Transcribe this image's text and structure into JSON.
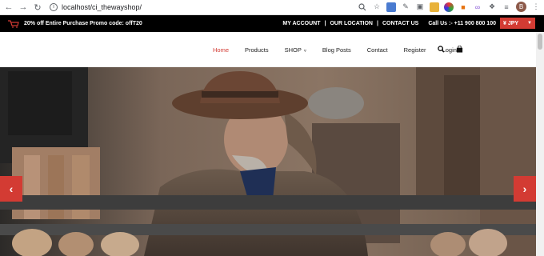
{
  "browser": {
    "url": "localhost/ci_thewayshop/",
    "profile_initial": "B"
  },
  "topbar": {
    "promo": "20% off Entire Purchase Promo code: offT20",
    "links": [
      "MY ACCOUNT",
      "OUR LOCATION",
      "CONTACT US"
    ],
    "separator": "|",
    "phone": "Call Us :- +11 900 800 100",
    "currency": "¥ JPY"
  },
  "nav": {
    "items": [
      "Home",
      "Products",
      "SHOP",
      "Blog Posts",
      "Contact",
      "Register",
      "Login"
    ],
    "active": "Home"
  },
  "colors": {
    "accent": "#d33b33",
    "topbar_bg": "#000000"
  },
  "icons": {
    "search": "search-icon",
    "bag": "shopping-bag-icon",
    "prev": "chevron-left-icon",
    "next": "chevron-right-icon"
  }
}
